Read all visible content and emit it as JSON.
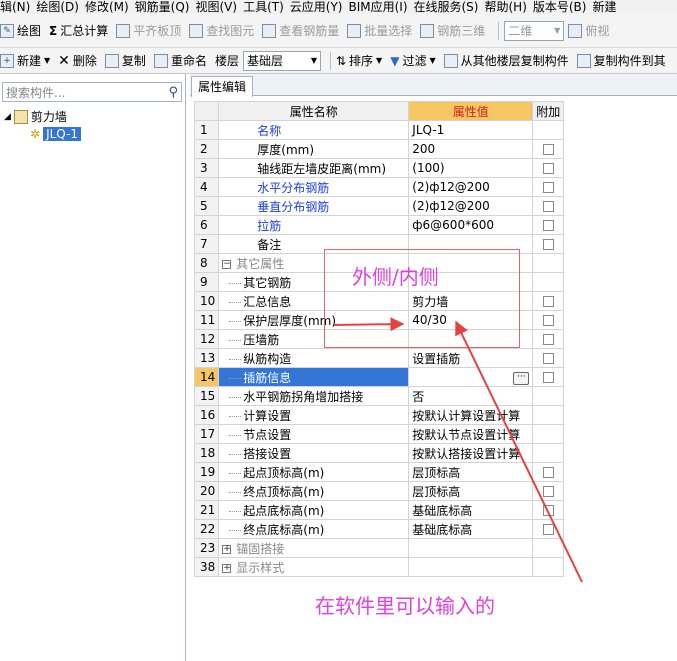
{
  "menu": [
    "辑(N)",
    "绘图(D)",
    "修改(M)",
    "钢筋量(Q)",
    "视图(V)",
    "工具(T)",
    "云应用(Y)",
    "BIM应用(I)",
    "在线服务(S)",
    "帮助(H)",
    "版本号(B)",
    "新建"
  ],
  "toolbar1": {
    "draw": "绘图",
    "sum": "汇总计算",
    "flush_slab": "平齐板顶",
    "find": "查找图元",
    "view_qty": "查看钢筋量",
    "batch_select": "批量选择",
    "rebar_3d": "钢筋三维",
    "view_mode": "二维",
    "view_dir": "俯视"
  },
  "toolbar2": {
    "new": "新建",
    "delete": "删除",
    "copy": "复制",
    "rename": "重命名",
    "floor_label": "楼层",
    "floor_value": "基础层",
    "sort": "排序",
    "filter": "过滤",
    "copy_from_other": "从其他楼层复制构件",
    "copy_to": "复制构件到其"
  },
  "search": {
    "placeholder": "搜索构件..."
  },
  "tree": {
    "root": "剪力墙",
    "child": "JLQ-1"
  },
  "tab": {
    "label": "属性编辑"
  },
  "table": {
    "col_name": "属性名称",
    "col_value": "属性值",
    "col_add": "附加"
  },
  "rows": [
    {
      "n": "1",
      "name": "名称",
      "value": "JLQ-1",
      "style": "blue",
      "check": false
    },
    {
      "n": "2",
      "name": "厚度(mm)",
      "value": "200",
      "style": "",
      "check": true
    },
    {
      "n": "3",
      "name": "轴线距左墙皮距离(mm)",
      "value": "(100)",
      "style": "",
      "check": true
    },
    {
      "n": "4",
      "name": "水平分布钢筋",
      "value": "(2)ф12@200",
      "style": "blue",
      "check": true
    },
    {
      "n": "5",
      "name": "垂直分布钢筋",
      "value": "(2)ф12@200",
      "style": "blue",
      "check": true
    },
    {
      "n": "6",
      "name": "拉筋",
      "value": "ф6@600*600",
      "style": "blue",
      "check": true
    },
    {
      "n": "7",
      "name": "备注",
      "value": "",
      "style": "",
      "check": true
    },
    {
      "n": "8",
      "name": "其它属性",
      "value": "",
      "style": "group-open",
      "check": false
    },
    {
      "n": "9",
      "name": "其它钢筋",
      "value": "",
      "style": "child",
      "check": false
    },
    {
      "n": "10",
      "name": "汇总信息",
      "value": "剪力墙",
      "style": "child",
      "check": true
    },
    {
      "n": "11",
      "name": "保护层厚度(mm)",
      "value": "40/30",
      "style": "child",
      "check": true
    },
    {
      "n": "12",
      "name": "压墙筋",
      "value": "",
      "style": "child",
      "check": true
    },
    {
      "n": "13",
      "name": "纵筋构造",
      "value": "设置插筋",
      "style": "child",
      "check": true
    },
    {
      "n": "14",
      "name": "插筋信息",
      "value": "",
      "style": "child-selected",
      "check": true
    },
    {
      "n": "15",
      "name": "水平钢筋拐角增加搭接",
      "value": "否",
      "style": "child",
      "check": false
    },
    {
      "n": "16",
      "name": "计算设置",
      "value": "按默认计算设置计算",
      "style": "child",
      "check": false
    },
    {
      "n": "17",
      "name": "节点设置",
      "value": "按默认节点设置计算",
      "style": "child",
      "check": false
    },
    {
      "n": "18",
      "name": "搭接设置",
      "value": "按默认搭接设置计算",
      "style": "child",
      "check": false
    },
    {
      "n": "19",
      "name": "起点顶标高(m)",
      "value": "层顶标高",
      "style": "child",
      "check": true
    },
    {
      "n": "20",
      "name": "终点顶标高(m)",
      "value": "层顶标高",
      "style": "child",
      "check": true
    },
    {
      "n": "21",
      "name": "起点底标高(m)",
      "value": "基础底标高",
      "style": "child",
      "check": true
    },
    {
      "n": "22",
      "name": "终点底标高(m)",
      "value": "基础底标高",
      "style": "child",
      "check": true
    },
    {
      "n": "23",
      "name": "锚固搭接",
      "value": "",
      "style": "group-closed",
      "check": false
    },
    {
      "n": "38",
      "name": "显示样式",
      "value": "",
      "style": "group-closed",
      "check": false
    }
  ],
  "annotations": {
    "box_text": "外侧/内侧",
    "bottom_text": "在软件里可以输入的",
    "color": "#e040e0"
  },
  "colors": {
    "header_value_bg": "#f6c664",
    "selection": "#3376d6",
    "link_blue": "#1b3fdb",
    "annotation_red": "#e84040"
  }
}
